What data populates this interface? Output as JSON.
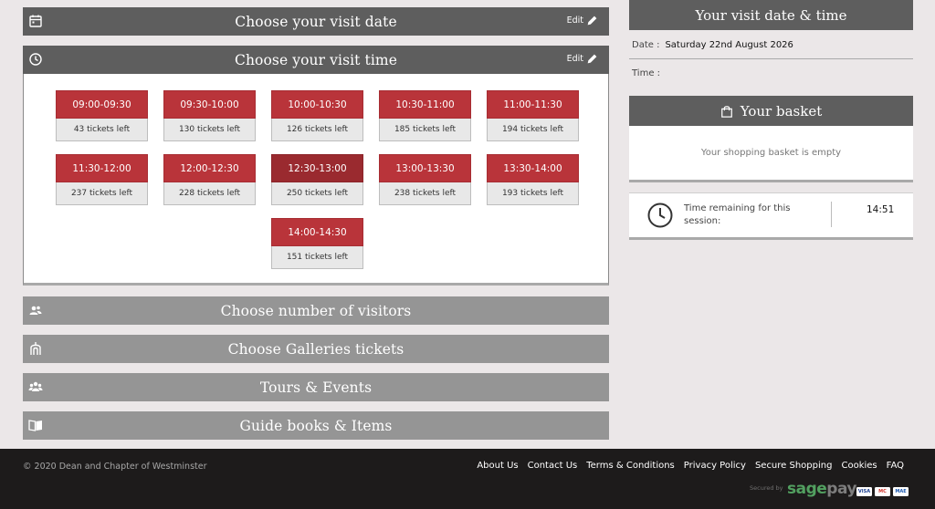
{
  "left": {
    "date_section": {
      "title": "Choose your visit date",
      "edit": "Edit"
    },
    "time_section": {
      "title": "Choose your visit time",
      "edit": "Edit"
    },
    "slots": [
      {
        "time": "09:00-09:30",
        "left": "43 tickets left"
      },
      {
        "time": "09:30-10:00",
        "left": "130 tickets left"
      },
      {
        "time": "10:00-10:30",
        "left": "126 tickets left"
      },
      {
        "time": "10:30-11:00",
        "left": "185 tickets left"
      },
      {
        "time": "11:00-11:30",
        "left": "194 tickets left"
      },
      {
        "time": "11:30-12:00",
        "left": "237 tickets left"
      },
      {
        "time": "12:00-12:30",
        "left": "228 tickets left"
      },
      {
        "time": "12:30-13:00",
        "left": "250 tickets left"
      },
      {
        "time": "13:00-13:30",
        "left": "238 tickets left"
      },
      {
        "time": "13:30-14:00",
        "left": "193 tickets left"
      },
      {
        "time": "14:00-14:30",
        "left": "151 tickets left"
      }
    ],
    "visitors_section": {
      "title": "Choose number of visitors"
    },
    "galleries_section": {
      "title": "Choose Galleries tickets"
    },
    "tours_section": {
      "title": "Tours & Events"
    },
    "guide_section": {
      "title": "Guide books & Items"
    }
  },
  "right": {
    "visit": {
      "title": "Your visit date & time",
      "date_label": "Date :",
      "date_value": "Saturday 22nd August 2026",
      "time_label": "Time :"
    },
    "basket": {
      "title": "Your basket",
      "empty": "Your shopping basket is empty"
    },
    "timer": {
      "label": "Time remaining for this session:",
      "value": "14:51"
    }
  },
  "footer": {
    "copyright": "© 2020 Dean and Chapter of Westminster",
    "links": [
      "About Us",
      "Contact Us",
      "Terms & Conditions",
      "Privacy Policy",
      "Secure Shopping",
      "Cookies",
      "FAQ"
    ],
    "secured_by": "Secured by",
    "sagepay_a": "sage",
    "sagepay_b": "pay",
    "cards": [
      "VISA",
      "MC",
      "MAE"
    ]
  },
  "colors": {
    "slot_red": "#b9343a",
    "slot_selected": "#9a2a2f",
    "header_dark": "#5e5e5e",
    "header_light": "#959595",
    "footer_bg": "#1d1b1b"
  }
}
